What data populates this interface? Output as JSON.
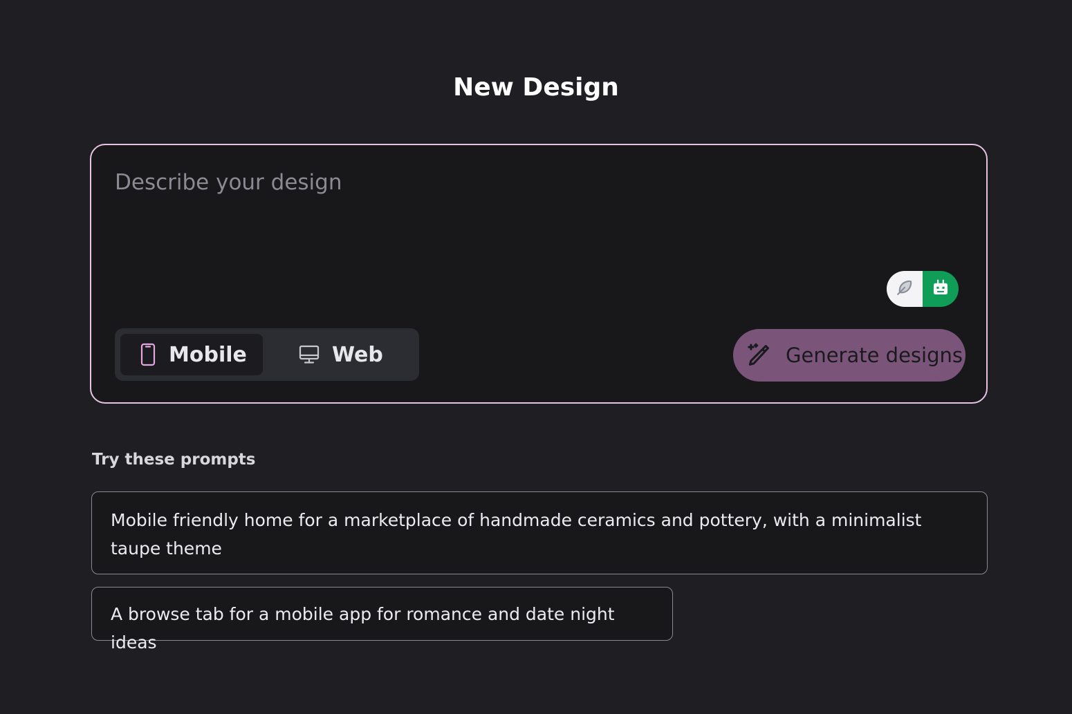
{
  "page": {
    "title": "New Design"
  },
  "composer": {
    "placeholder": "Describe your design",
    "model_toggle": {
      "left_icon": "feather-icon",
      "right_icon": "robot-icon",
      "right_color": "#0f9d58"
    },
    "device_options": [
      {
        "label": "Mobile",
        "icon": "phone-icon",
        "active": true
      },
      {
        "label": "Web",
        "icon": "monitor-icon",
        "active": false
      }
    ],
    "generate_label": "Generate designs",
    "generate_icon": "magic-wand-icon",
    "accent_color": "#7a5579",
    "border_color": "#e8c4e4"
  },
  "prompts": {
    "heading": "Try these prompts",
    "items": [
      {
        "text": "Mobile friendly home for a marketplace of handmade ceramics and pottery, with a minimalist taupe theme"
      },
      {
        "text": "A browse tab for a mobile app for romance and date night ideas"
      }
    ]
  }
}
